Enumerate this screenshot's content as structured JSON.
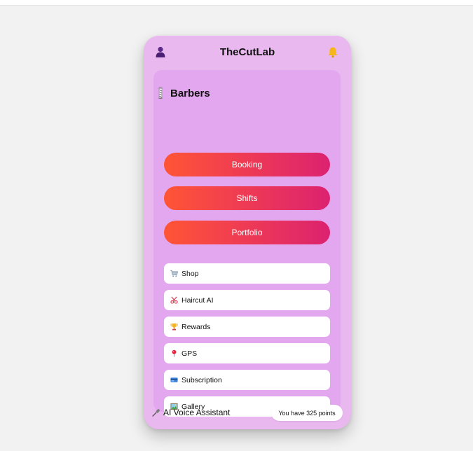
{
  "app": {
    "title": "TheCutLab"
  },
  "header": {
    "left_icon": "user-avatar-icon",
    "right_icon": "bell-icon"
  },
  "section": {
    "title": "Barbers",
    "icon": "barber-pole-icon"
  },
  "primary_actions": [
    {
      "label": "Booking"
    },
    {
      "label": "Shifts"
    },
    {
      "label": "Portfolio"
    }
  ],
  "menu": [
    {
      "label": "Shop",
      "icon": "shopping-cart-icon"
    },
    {
      "label": "Haircut AI",
      "icon": "scissors-icon"
    },
    {
      "label": "Rewards",
      "icon": "trophy-icon"
    },
    {
      "label": "GPS",
      "icon": "map-pin-icon"
    },
    {
      "label": "Subscription",
      "icon": "credit-card-icon"
    },
    {
      "label": "Gallery",
      "icon": "picture-icon"
    }
  ],
  "footer": {
    "voice_label": "AI Voice Assistant",
    "voice_icon": "microphone-icon",
    "points_text": "You have 325 points"
  },
  "colors": {
    "page_background": "#f2f2f2",
    "phone_background": "#e9b8ef",
    "panel_background": "#e3a7ef",
    "button_gradient_start": "#ff5535",
    "button_gradient_end": "#dc2270",
    "card_background": "#ffffff"
  }
}
